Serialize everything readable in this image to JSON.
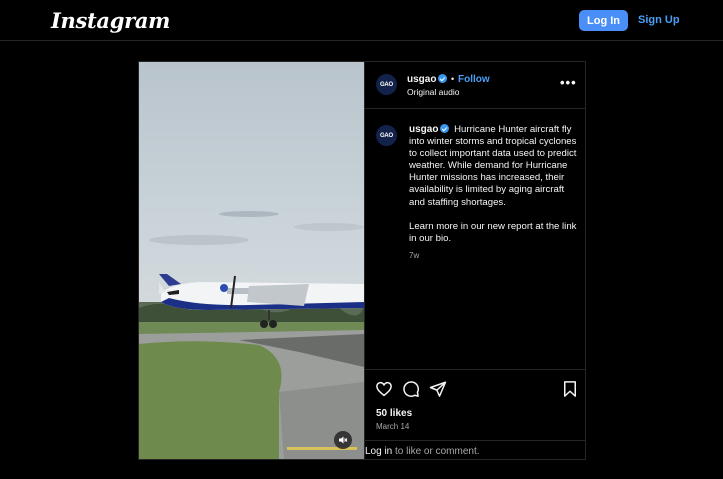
{
  "topbar": {
    "logo": "Instagram",
    "login_label": "Log In",
    "signup_label": "Sign Up"
  },
  "post": {
    "author": {
      "username": "usgao",
      "avatar_text": "GAO",
      "verified": true
    },
    "follow_label": "Follow",
    "separator": "•",
    "audio": "Original audio",
    "more_icon": "more-icon",
    "caption": {
      "paragraph1": "Hurricane Hunter aircraft fly into winter storms and tropical cyclones to collect important data used to predict weather. While demand for Hurricane Hunter missions has increased, their availability is limited by aging aircraft and staffing shortages.",
      "paragraph2": "Learn more in our new report at the link in our bio."
    },
    "age": "7w",
    "likes": "50 likes",
    "date": "March 14",
    "comment": {
      "login_link": "Log in",
      "rest": " to like or comment."
    },
    "icons": {
      "like": "heart-icon",
      "comment": "comment-icon",
      "share": "share-icon",
      "save": "bookmark-icon",
      "mute": "muted-speaker-icon"
    }
  },
  "colors": {
    "background": "#000000",
    "accent": "#4a8ef7",
    "avatar": "#13224a",
    "divider": "#262626",
    "verified": "#3897f0"
  }
}
